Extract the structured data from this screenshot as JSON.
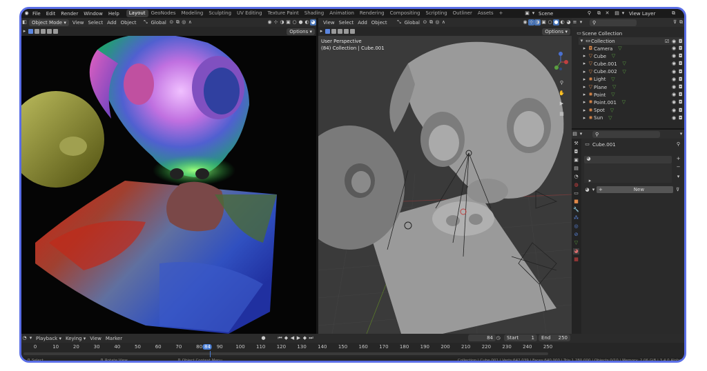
{
  "menu": [
    "File",
    "Edit",
    "Render",
    "Window",
    "Help"
  ],
  "workspaces": [
    "Layout",
    "GeoNodes",
    "Modeling",
    "Sculpting",
    "UV Editing",
    "Texture Paint",
    "Shading",
    "Animation",
    "Rendering",
    "Compositing",
    "Scripting",
    "Outliner",
    "Assets"
  ],
  "active_workspace": "Layout",
  "plus_tab": "+",
  "scene": {
    "label": "Scene",
    "view_layer": "View Layer"
  },
  "left_header": {
    "mode": "Object Mode",
    "view": "View",
    "select": "Select",
    "add": "Add",
    "object": "Object",
    "orientation": "Global",
    "options": "Options"
  },
  "right_header": {
    "view": "View",
    "select": "Select",
    "add": "Add",
    "object": "Object",
    "orientation": "Global",
    "options": "Options"
  },
  "viewport_overlay": {
    "line1": "User Perspective",
    "line2": "(84) Collection | Cube.001"
  },
  "outliner": {
    "root": "Scene Collection",
    "collection": "Collection",
    "items": [
      {
        "name": "Camera",
        "icon": "camera-icon",
        "color": "#e08a4a"
      },
      {
        "name": "Cube",
        "icon": "mesh-icon",
        "color": "#e08a4a"
      },
      {
        "name": "Cube.001",
        "icon": "mesh-icon",
        "color": "#e08a4a"
      },
      {
        "name": "Cube.002",
        "icon": "mesh-icon",
        "color": "#e08a4a"
      },
      {
        "name": "Light",
        "icon": "light-icon",
        "color": "#e08a4a"
      },
      {
        "name": "Plane",
        "icon": "mesh-icon",
        "color": "#e08a4a"
      },
      {
        "name": "Point",
        "icon": "light-icon",
        "color": "#e08a4a"
      },
      {
        "name": "Point.001",
        "icon": "light-icon",
        "color": "#e08a4a"
      },
      {
        "name": "Spot",
        "icon": "light-icon",
        "color": "#e08a4a"
      },
      {
        "name": "Sun",
        "icon": "light-icon",
        "color": "#e08a4a"
      }
    ]
  },
  "properties": {
    "object_name": "Cube.001",
    "new_button": "New"
  },
  "timeline": {
    "playback": "Playback",
    "keying": "Keying",
    "view": "View",
    "marker": "Marker",
    "current_frame": "84",
    "start_label": "Start",
    "start": "1",
    "end_label": "End",
    "end": "250",
    "ticks": [
      "0",
      "10",
      "20",
      "30",
      "40",
      "50",
      "60",
      "70",
      "80",
      "84",
      "90",
      "100",
      "110",
      "120",
      "130",
      "140",
      "150",
      "160",
      "170",
      "180",
      "190",
      "200",
      "210",
      "220",
      "230",
      "240",
      "250"
    ]
  },
  "status_bar": {
    "select": "Select",
    "rotate": "Rotate View",
    "context": "Object Context Menu",
    "stats": "Collection | Cube.001 | Verts:642,039 | Faces:640,000 | Tris:1,280,000 | Objects:0/10 | Memory: 2.06 GiB | 3.4.0 Alpha"
  },
  "colors": {
    "accent": "#5a6ee6",
    "active_blue": "#4772b3",
    "frame_marker": "#4a7fd8"
  }
}
